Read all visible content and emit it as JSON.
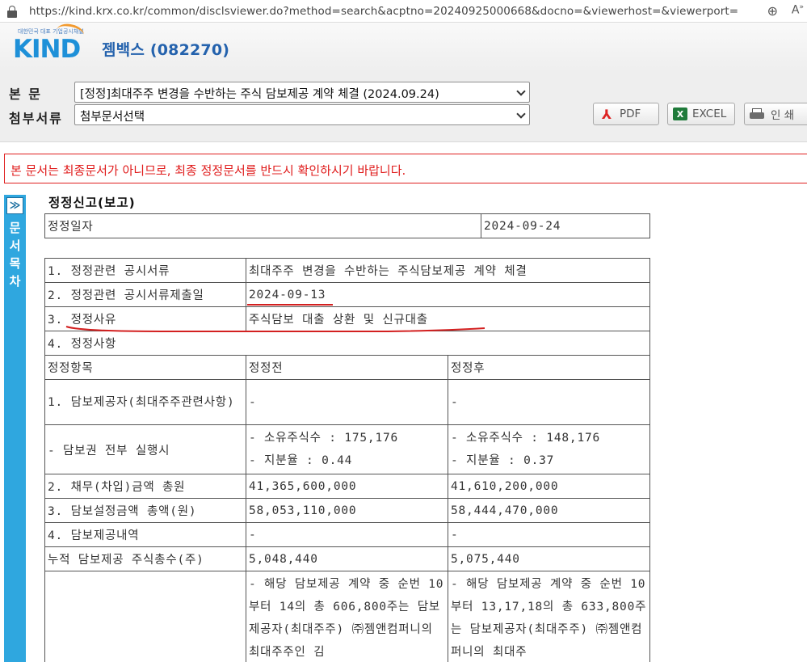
{
  "browser": {
    "url": "https://kind.krx.co.kr/common/disclsviewer.do?method=search&acptno=20240925000668&docno=&viewerhost=&viewerport="
  },
  "header": {
    "logo_tagline": "대한민국 대표 기업공시채널",
    "logo_text": "KIND",
    "company": "젬백스 (082270)"
  },
  "controls": {
    "main_label": "본 문",
    "main_selected": "[정정]최대주주 변경을 수반하는 주식 담보제공 계약 체결 (2024.09.24)",
    "attach_label": "첨부서류",
    "attach_selected": "첨부문서선택",
    "pdf_label": "PDF",
    "excel_label": "EXCEL",
    "print_label": "인 쇄"
  },
  "warning": "본 문서는 최종문서가 아니므로, 최종 정정문서를 반드시 확인하시기 바랍니다.",
  "sidebar": {
    "toggle": "≫",
    "label": "문서목차"
  },
  "doc": {
    "title": "정정신고(보고)",
    "date_label": "정정일자",
    "date_value": "2024-09-24",
    "rows": {
      "r1_label": "1. 정정관련 공시서류",
      "r1_value": "최대주주 변경을 수반하는 주식담보제공 계약 체결",
      "r2_label": "2. 정정관련 공시서류제출일",
      "r2_value": "2024-09-13",
      "r3_label": "3. 정정사유",
      "r3_value": "주식담보 대출 상환 및 신규대출",
      "r4_label": "4. 정정사항"
    },
    "columns": [
      "정정항목",
      "정정전",
      "정정후"
    ],
    "items": [
      {
        "item": "1. 담보제공자(최대주주관련사항)",
        "before": "-",
        "after": "-"
      },
      {
        "item": "- 담보권 전부 실행시",
        "before_1": "- 소유주식수 : 175,176",
        "before_2": "- 지분율 : 0.44",
        "after_1": "- 소유주식수 : 148,176",
        "after_2": "- 지분율 : 0.37"
      },
      {
        "item": "2. 채무(차입)금액 총원",
        "before": "41,365,600,000",
        "after": "41,610,200,000"
      },
      {
        "item": "3. 담보설정금액 총액(원)",
        "before": "58,053,110,000",
        "after": "58,444,470,000"
      },
      {
        "item": "4. 담보제공내역",
        "before": "-",
        "after": "-"
      },
      {
        "item": "누적 담보제공 주식총수(주)",
        "before": "5,048,440",
        "after": "5,075,440"
      },
      {
        "item": "",
        "before": "- 해당 담보제공 계약 중 순번 10부터 14의 총 606,800주는 담보제공자(최대주주) ㈜젬앤컴퍼니의 최대주주인 김",
        "after": "- 해당 담보제공 계약 중 순번 10부터 13,17,18의 총 633,800주는 담보제공자(최대주주) ㈜젬앤컴퍼니의 최대주"
      }
    ]
  }
}
